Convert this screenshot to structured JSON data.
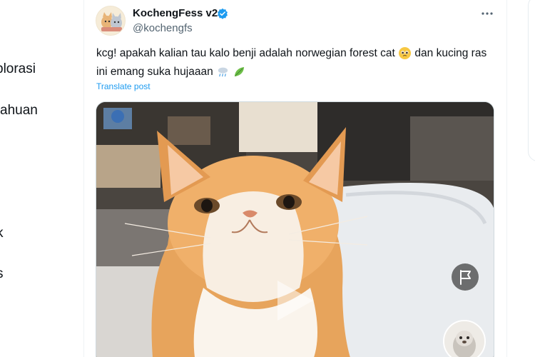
{
  "nav": {
    "explore_label": "plorasi",
    "notifications_label": "ahuan",
    "item_k": "k",
    "item_s": "s"
  },
  "tweet": {
    "author": {
      "name": "KochengFess v2",
      "handle": "@kochengfs",
      "verified": true
    },
    "text_part1": "kcg! apakah kalian tau kalo benji adalah norwegian forest cat",
    "text_part2": "dan kucing ras ini emang suka hujaaan",
    "translate_label": "Translate post",
    "media_type": "video"
  },
  "icons": {
    "verified": "verified-badge-icon",
    "more": "more-dots-icon",
    "flag": "flag-icon",
    "play": "play-icon"
  },
  "colors": {
    "accent": "#1d9bf0",
    "text": "#0f1419",
    "secondary": "#536471"
  }
}
